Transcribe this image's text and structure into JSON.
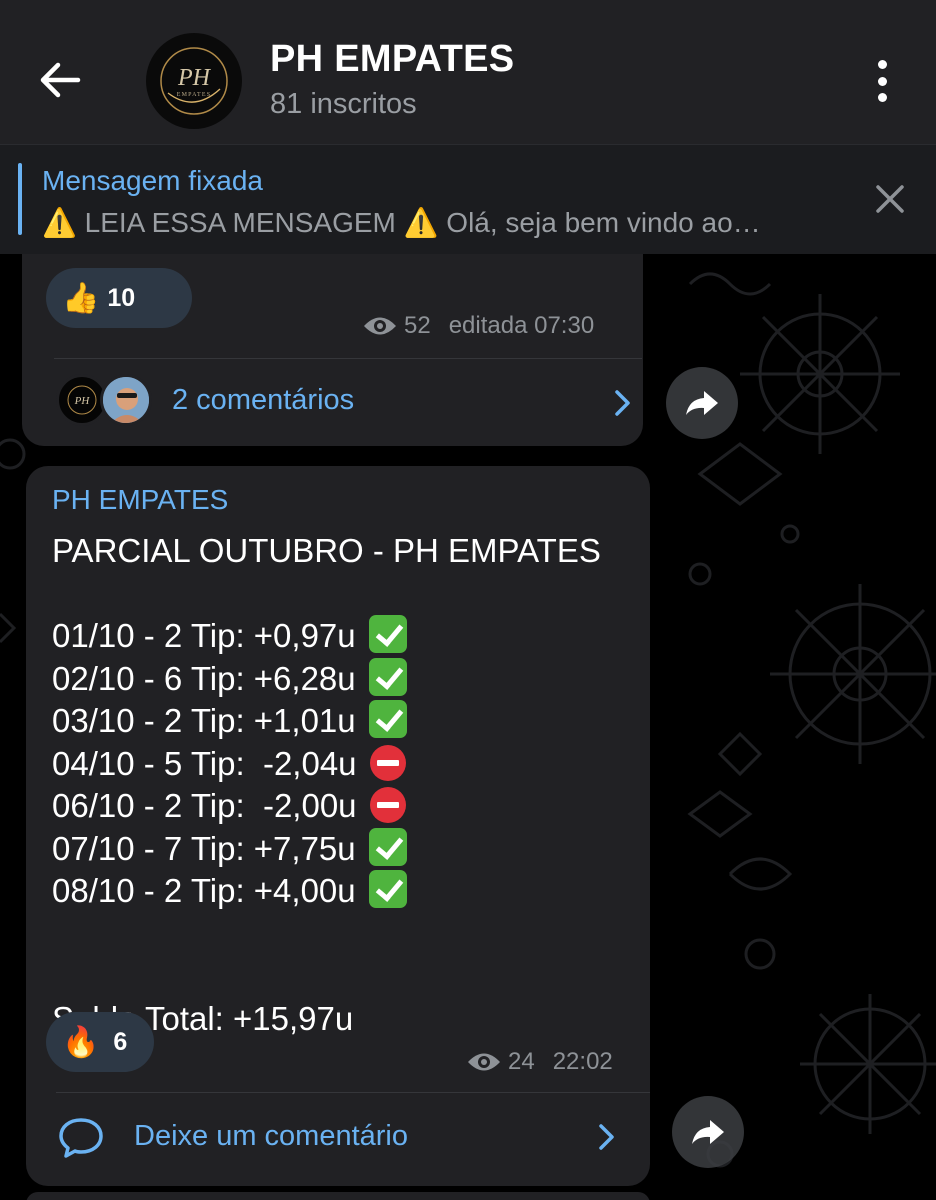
{
  "header": {
    "title": "PH EMPATES",
    "subtitle": "81 inscritos",
    "avatar_text_top": "PH",
    "avatar_text_bottom": "EMPATES",
    "icons": [
      "back-arrow-icon",
      "more-vertical-icon"
    ]
  },
  "pinned": {
    "title": "Mensagem fixada",
    "text": "⚠️ LEIA ESSA MENSAGEM ⚠️  Olá, seja bem vindo ao…",
    "icon": "close-icon"
  },
  "message1": {
    "reaction_emoji": "👍",
    "reaction_count": "10",
    "views": "52",
    "time": "editada 07:30",
    "comments_label": "2 comentários",
    "icons": [
      "eye-icon",
      "chevron-right-icon",
      "share-icon"
    ]
  },
  "message2": {
    "sender": "PH EMPATES",
    "title": "PARCIAL OUTUBRO - PH EMPATES",
    "lines": [
      {
        "text": "01/10 - 2 Tip: +0,97u",
        "status": "green"
      },
      {
        "text": "02/10 - 6 Tip: +6,28u",
        "status": "green"
      },
      {
        "text": "03/10 - 2 Tip: +1,01u",
        "status": "green"
      },
      {
        "text": "04/10 - 5 Tip:  -2,04u",
        "status": "red"
      },
      {
        "text": "06/10 - 2 Tip:  -2,00u",
        "status": "red"
      },
      {
        "text": "07/10 - 7 Tip: +7,75u",
        "status": "green"
      },
      {
        "text": "08/10 - 2 Tip: +4,00u",
        "status": "green"
      }
    ],
    "total": "Saldo Total: +15,97u",
    "reaction_emoji": "🔥",
    "reaction_count": "6",
    "views": "24",
    "time": "22:02",
    "comment_prompt": "Deixe um comentário",
    "icons": [
      "eye-icon",
      "comment-bubble-icon",
      "chevron-right-icon",
      "share-icon"
    ]
  },
  "colors": {
    "accent": "#6ab2f2",
    "bubble": "#212124",
    "header": "#212124",
    "reaction_bg": "#2d3845",
    "green_check": "#4fb43e",
    "red_stop": "#e2303a"
  }
}
